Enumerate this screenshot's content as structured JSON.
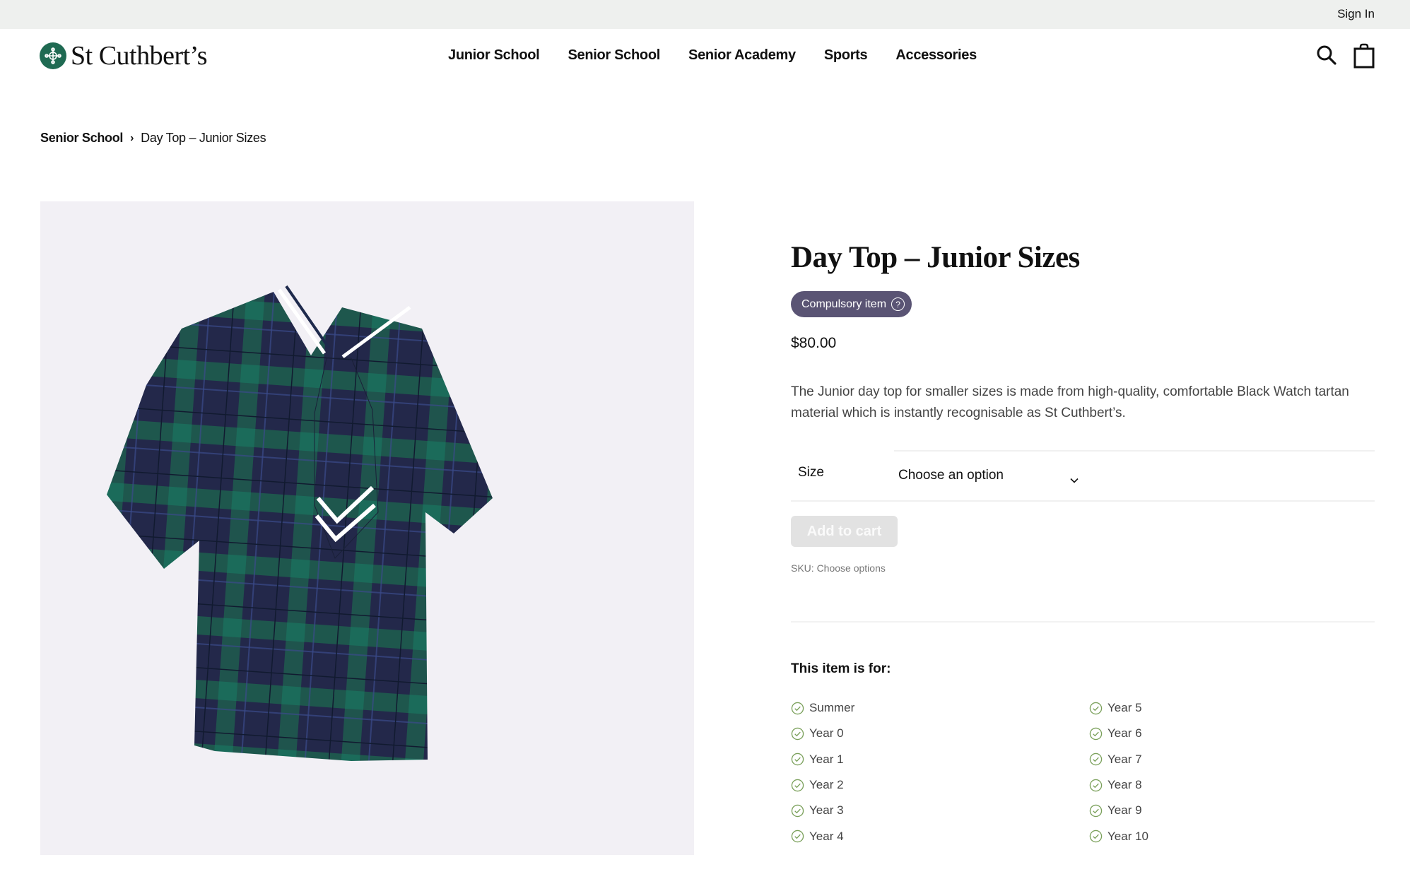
{
  "topbar": {
    "sign_in": "Sign In"
  },
  "brand": {
    "name": "St Cuthbert’s",
    "color": "#1f6a52"
  },
  "nav": {
    "items": [
      {
        "label": "Junior School"
      },
      {
        "label": "Senior School"
      },
      {
        "label": "Senior Academy"
      },
      {
        "label": "Sports"
      },
      {
        "label": "Accessories"
      }
    ],
    "icons": {
      "search": "search-icon",
      "cart": "shopping-bag-icon"
    }
  },
  "breadcrumb": {
    "parent": "Senior School",
    "separator": "›",
    "current": "Day Top – Junior Sizes"
  },
  "product": {
    "title": "Day Top – Junior Sizes",
    "badge": {
      "label": "Compulsory item",
      "help_glyph": "?",
      "color": "#5a5474"
    },
    "price": "$80.00",
    "description": "The Junior day top for smaller sizes is made from high-quality, comfortable Black Watch tartan material which is instantly recognisable as St Cuthbert’s.",
    "image_alt": "Black Watch tartan day top with sailor collar and tie",
    "size": {
      "label": "Size",
      "selected": "Choose an option"
    },
    "add_to_cart": "Add to cart",
    "sku": "SKU: Choose options"
  },
  "eligibility": {
    "title": "This item is for:",
    "check_color": "#7aa05a",
    "col1": [
      "Summer",
      "Year 0",
      "Year 1",
      "Year 2",
      "Year 3",
      "Year 4"
    ],
    "col2": [
      "Year 5",
      "Year 6",
      "Year 7",
      "Year 8",
      "Year 9",
      "Year 10"
    ]
  }
}
